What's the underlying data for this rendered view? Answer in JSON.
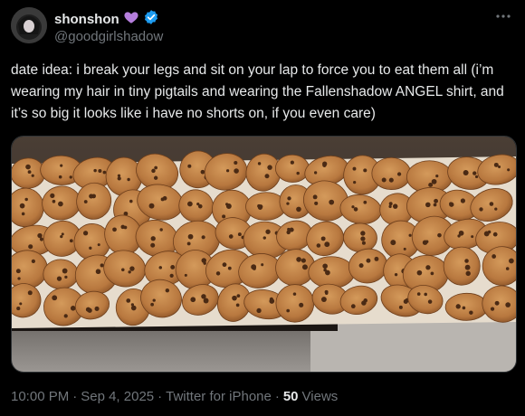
{
  "author": {
    "display_name": "shonshon",
    "handle": "@goodgirlshadow",
    "emoji": "purple-heart",
    "verified": true
  },
  "post": {
    "text": "date idea: i break your legs and sit on your lap to force you to eat them all (i’m wearing my hair in tiny pigtails and wearing the Fallenshadow ANGEL shirt, and it’s so big it looks like i have no shorts on, if you even care)",
    "image_subject": "cookies"
  },
  "meta": {
    "time": "10:00 PM",
    "sep1": "·",
    "date": "Sep 4, 2025",
    "sep2": "·",
    "client": "Twitter for iPhone",
    "sep3": "·",
    "views_count": "50",
    "views_label": "Views"
  },
  "colors": {
    "background": "#000000",
    "text": "#e7e9ea",
    "secondary": "#71767b",
    "verified": "#1d9bf0",
    "heart": "#b57edc"
  },
  "icons": [
    "more-icon",
    "verified-badge-icon",
    "purple-heart-icon"
  ]
}
